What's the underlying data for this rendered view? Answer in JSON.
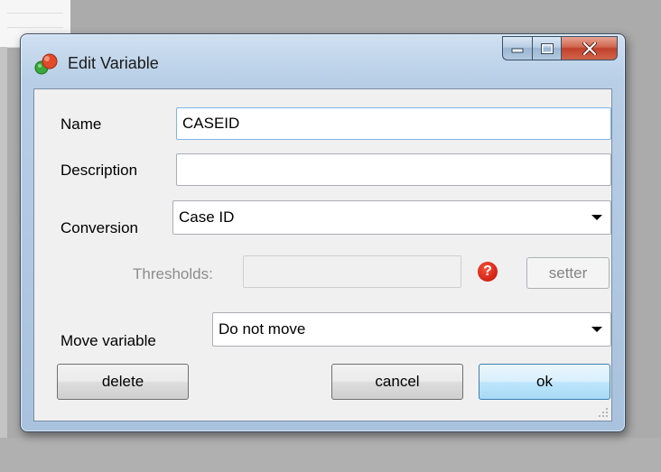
{
  "window": {
    "title": "Edit Variable"
  },
  "form": {
    "name_label": "Name",
    "name_value": "CASEID",
    "description_label": "Description",
    "description_value": "",
    "conversion_label": "Conversion",
    "conversion_value": "Case ID",
    "thresholds_label": "Thresholds:",
    "thresholds_value": "",
    "help_glyph": "?",
    "setter_label": "setter",
    "move_label": "Move variable",
    "move_value": "Do not move"
  },
  "buttons": {
    "delete": "delete",
    "cancel": "cancel",
    "ok": "ok"
  },
  "icons": {
    "app": "app-icon",
    "minimize": "minimize-icon",
    "maximize": "maximize-icon",
    "close": "close-icon",
    "help": "help-icon",
    "dropdown": "chevron-down-icon",
    "grip": "resize-grip-icon"
  },
  "colors": {
    "accent": "#3c7fb1",
    "close_button": "#c0412a",
    "help_icon": "#d8261a"
  }
}
